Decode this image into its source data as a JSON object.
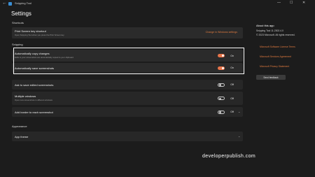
{
  "titlebar": {
    "back_glyph": "←",
    "app_title": "Snipping Tool",
    "minimize_glyph": "—",
    "maximize_glyph": "☐",
    "close_glyph": "✕"
  },
  "page_title": "Settings",
  "sections": {
    "shortcuts": {
      "label": "Shortcuts",
      "print_screen": {
        "title": "Print Screen key shortcut",
        "subtitle": "Open Snipping Tool when you press the Print Screen key",
        "link": "Change in Windows settings"
      }
    },
    "snipping": {
      "label": "Snipping",
      "auto_copy": {
        "title": "Automatically copy changes",
        "subtitle": "Edits to your screenshots are automatically copied to your clipboard",
        "state": "On"
      },
      "auto_save": {
        "title": "Automatically save screenshots",
        "state": "On"
      },
      "ask_save": {
        "title": "Ask to save edited screenshots",
        "state": "Off"
      },
      "multiple_windows": {
        "title": "Multiple windows",
        "subtitle": "Open new screenshots in different windows",
        "state": "Off"
      },
      "add_border": {
        "title": "Add border to each screenshot",
        "state": "Off"
      }
    },
    "appearance": {
      "label": "Appearance",
      "app_theme": {
        "title": "App theme"
      }
    }
  },
  "about": {
    "title": "About this app",
    "version": "Snipping Tool 11.2302.4.0",
    "copyright": "© 2023 Microsoft. All rights reserved.",
    "links": [
      "Microsoft Software License Terms",
      "Microsoft Services Agreement",
      "Microsoft Privacy Statement"
    ],
    "feedback_button": "Send feedback"
  },
  "watermark": "developerpublish.com",
  "colors": {
    "accent": "#e8754a",
    "link": "#e07a3f",
    "background": "#1c1c1c",
    "card": "#2b2b2b"
  }
}
